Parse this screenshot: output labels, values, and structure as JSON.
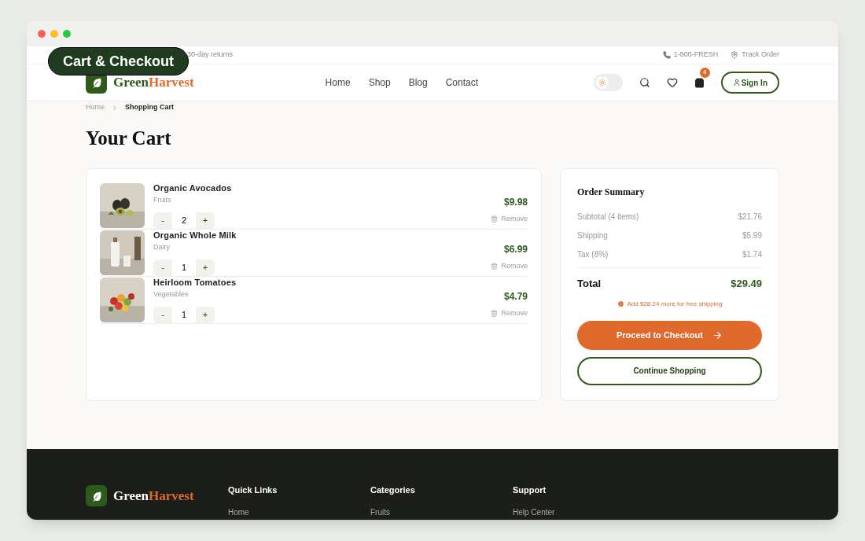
{
  "overlay_label": "Cart & Checkout",
  "top_bar": {
    "note": "30-day returns",
    "phone": "1-800-FRESH",
    "track": "Track Order"
  },
  "brand": {
    "primary": "Green",
    "accent": "Harvest"
  },
  "nav": [
    "Home",
    "Shop",
    "Blog",
    "Contact"
  ],
  "theme_toggle": {
    "on": false
  },
  "cart_badge": "4",
  "sign_in": "Sign In",
  "breadcrumb": [
    "Home",
    "Shopping Cart"
  ],
  "page_title": "Your Cart",
  "cart_items": [
    {
      "name": "Organic Avocados",
      "category": "Fruits",
      "quantity": "2",
      "price": "$9.98",
      "remove": "Remove",
      "minus": "-",
      "plus": "+"
    },
    {
      "name": "Organic Whole Milk",
      "category": "Dairy",
      "quantity": "1",
      "price": "$6.99",
      "remove": "Remove",
      "minus": "-",
      "plus": "+"
    },
    {
      "name": "Heirloom Tomatoes",
      "category": "Vegetables",
      "quantity": "1",
      "price": "$4.79",
      "remove": "Remove",
      "minus": "-",
      "plus": "+"
    }
  ],
  "summary": {
    "title": "Order Summary",
    "lines": [
      {
        "label": "Subtotal (4 items)",
        "value": "$21.76"
      },
      {
        "label": "Shipping",
        "value": "$5.99"
      },
      {
        "label": "Tax (8%)",
        "value": "$1.74"
      }
    ],
    "total_label": "Total",
    "total_value": "$29.49",
    "notice": "Add $28.24 more for free shipping",
    "checkout": "Proceed to Checkout",
    "continue": "Continue Shopping"
  },
  "footer": {
    "brand": {
      "primary": "Green",
      "accent": "Harvest"
    },
    "columns": [
      {
        "heading": "Quick Links",
        "first_link": "Home"
      },
      {
        "heading": "Categories",
        "first_link": "Fruits"
      },
      {
        "heading": "Support",
        "first_link": "Help Center"
      }
    ]
  }
}
